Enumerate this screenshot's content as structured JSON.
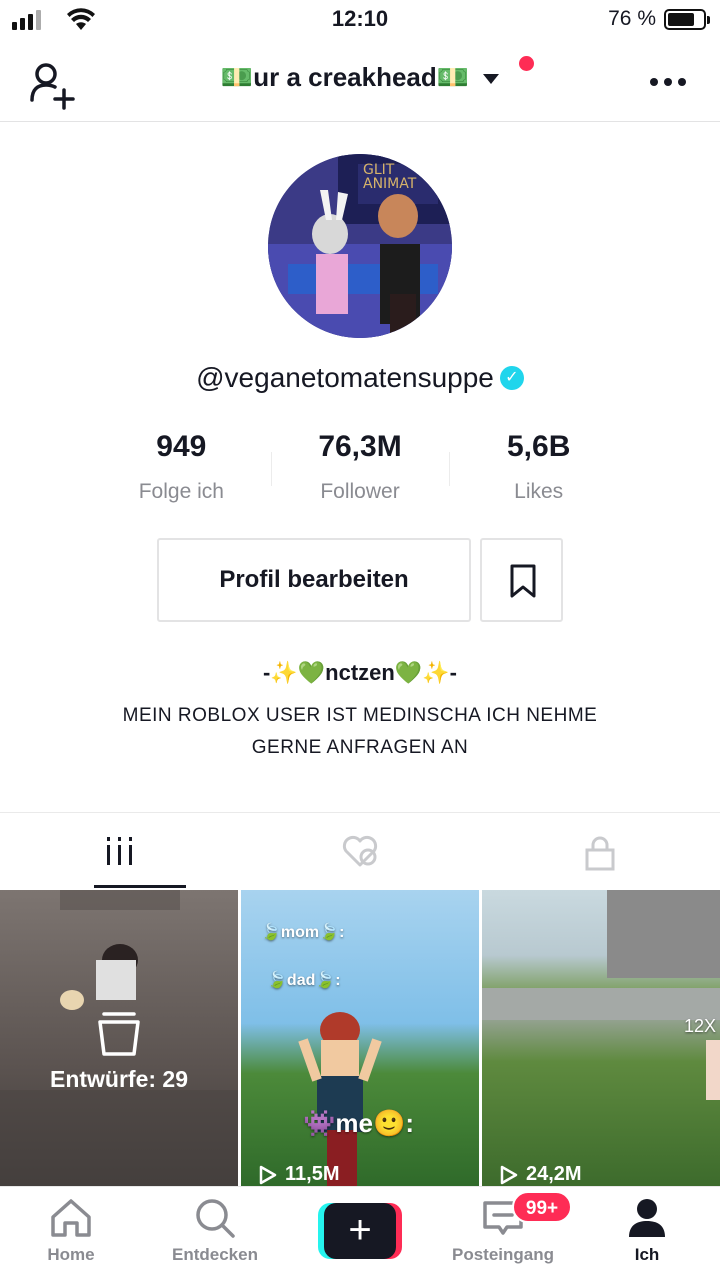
{
  "status_bar": {
    "time": "12:10",
    "battery_percent": "76 %",
    "battery_level": 0.76
  },
  "header": {
    "title": "💵ur a creakhead💵",
    "has_notification": true
  },
  "profile": {
    "username": "@veganetomatensuppe",
    "verified": true,
    "stats": [
      {
        "value": "949",
        "label": "Folge ich"
      },
      {
        "value": "76,3M",
        "label": "Follower"
      },
      {
        "value": "5,6B",
        "label": "Likes"
      }
    ],
    "edit_button": "Profil bearbeiten",
    "bio_line1": "-✨💚nctzen💚✨-",
    "bio_line2": "MEIN ROBLOX USER IST MEDINSCHA ICH NEHME GERNE ANFRAGEN AN"
  },
  "tabs": [
    {
      "name": "videos",
      "icon": "grid-icon",
      "active": true
    },
    {
      "name": "liked",
      "icon": "heart-hidden-icon",
      "active": false
    },
    {
      "name": "private",
      "icon": "lock-icon",
      "active": false
    }
  ],
  "grid": {
    "drafts_label": "Entwürfe: 29",
    "videos": [
      {
        "views": "11,5M",
        "overlay_lines": [
          "🍃mom🍃:",
          "🍃dad🍃:",
          "👾me🙂:"
        ]
      },
      {
        "views": "24,2M",
        "overlay_lines": [
          "12X"
        ]
      }
    ]
  },
  "bottom_nav": {
    "items": [
      {
        "label": "Home",
        "icon": "home-icon"
      },
      {
        "label": "Entdecken",
        "icon": "search-icon"
      },
      {
        "label": "",
        "icon": "create-icon"
      },
      {
        "label": "Posteingang",
        "icon": "inbox-icon",
        "badge": "99+"
      },
      {
        "label": "Ich",
        "icon": "profile-icon",
        "active": true
      }
    ]
  },
  "colors": {
    "accent": "#fe2c55",
    "cyan": "#25f4ee",
    "verified": "#20d5ec",
    "text": "#161823",
    "muted": "#8a8b91"
  }
}
